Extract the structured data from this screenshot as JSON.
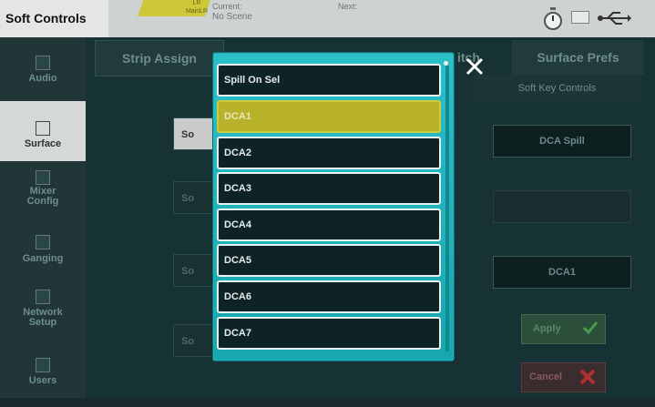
{
  "titlebar": {
    "app_title": "Soft Controls",
    "mix_line1": "LR",
    "mix_line2": "MainLR",
    "current_label": "Current:",
    "current_value": "No Scene",
    "next_label": "Next:",
    "icons": [
      "stopwatch-icon",
      "network-icon",
      "usb-icon"
    ]
  },
  "sidebar": {
    "items": [
      {
        "label": "Audio",
        "icon": "audio-icon"
      },
      {
        "label": "Surface",
        "icon": "surface-icon",
        "active": true
      },
      {
        "label1": "Mixer",
        "label2": "Config",
        "icon": "mixer-config-icon"
      },
      {
        "label": "Ganging",
        "icon": "ganging-icon"
      },
      {
        "label1": "Network",
        "label2": "Setup",
        "icon": "network-setup-icon"
      },
      {
        "label": "Users",
        "icon": "users-icon"
      }
    ]
  },
  "tabs": {
    "strip_assign": "Strip Assign",
    "switch_partial": "itch",
    "surface_prefs": "Surface Prefs"
  },
  "soft_key_header": "Soft Key Controls",
  "left_buttons": [
    "So",
    "So",
    "So",
    "So"
  ],
  "right_panel": {
    "field1": "DCA Spill",
    "field2": "",
    "field3": "DCA1",
    "apply_label": "Apply",
    "cancel_label": "Cancel"
  },
  "popup": {
    "items": [
      "Spill On Sel",
      "DCA1",
      "DCA2",
      "DCA3",
      "DCA4",
      "DCA5",
      "DCA6",
      "DCA7"
    ],
    "selected_index": 1,
    "close_icon": "close-icon"
  },
  "colors": {
    "selected": "#b8b22a",
    "popup_frame": "#20b4bc",
    "title_tag": "#cdc83a"
  }
}
